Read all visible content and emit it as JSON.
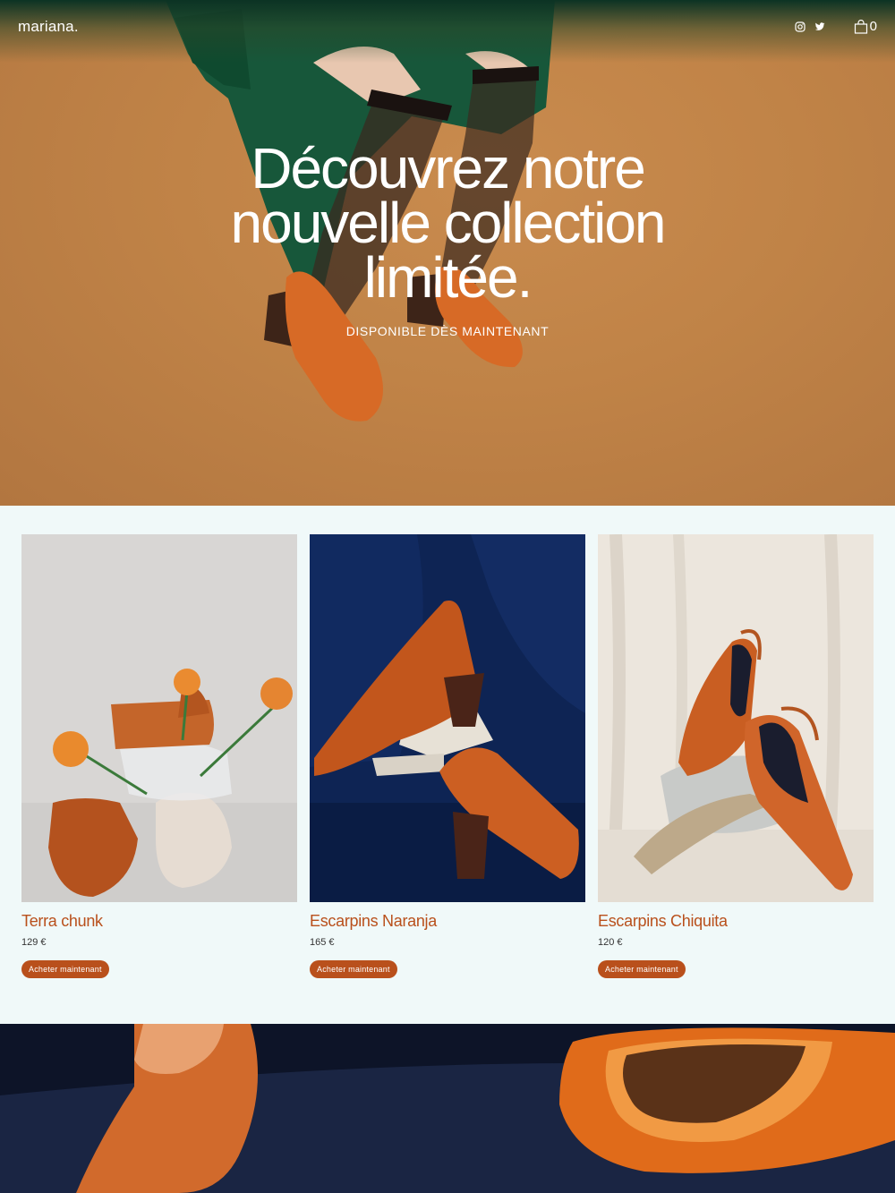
{
  "header": {
    "brand": "mariana.",
    "cart_count": "0",
    "icons": [
      "instagram-icon",
      "twitter-icon",
      "shopping-bag-icon"
    ]
  },
  "hero": {
    "title_lines": [
      "Découvrez notre",
      "nouvelle collection",
      "limitée."
    ],
    "subtitle": "DISPONIBLE DÈS MAINTENANT"
  },
  "products": [
    {
      "name": "Terra chunk",
      "price": "129 €",
      "cta": "Acheter maintenant"
    },
    {
      "name": "Escarpins Naranja",
      "price": "165 €",
      "cta": "Acheter maintenant"
    },
    {
      "name": "Escarpins Chiquita",
      "price": "120 €",
      "cta": "Acheter maintenant"
    }
  ],
  "colors": {
    "accent": "#b9501c",
    "section_bg": "#f0f9f9",
    "hero_bg": "#c08347",
    "header_dark": "#0c3324"
  }
}
